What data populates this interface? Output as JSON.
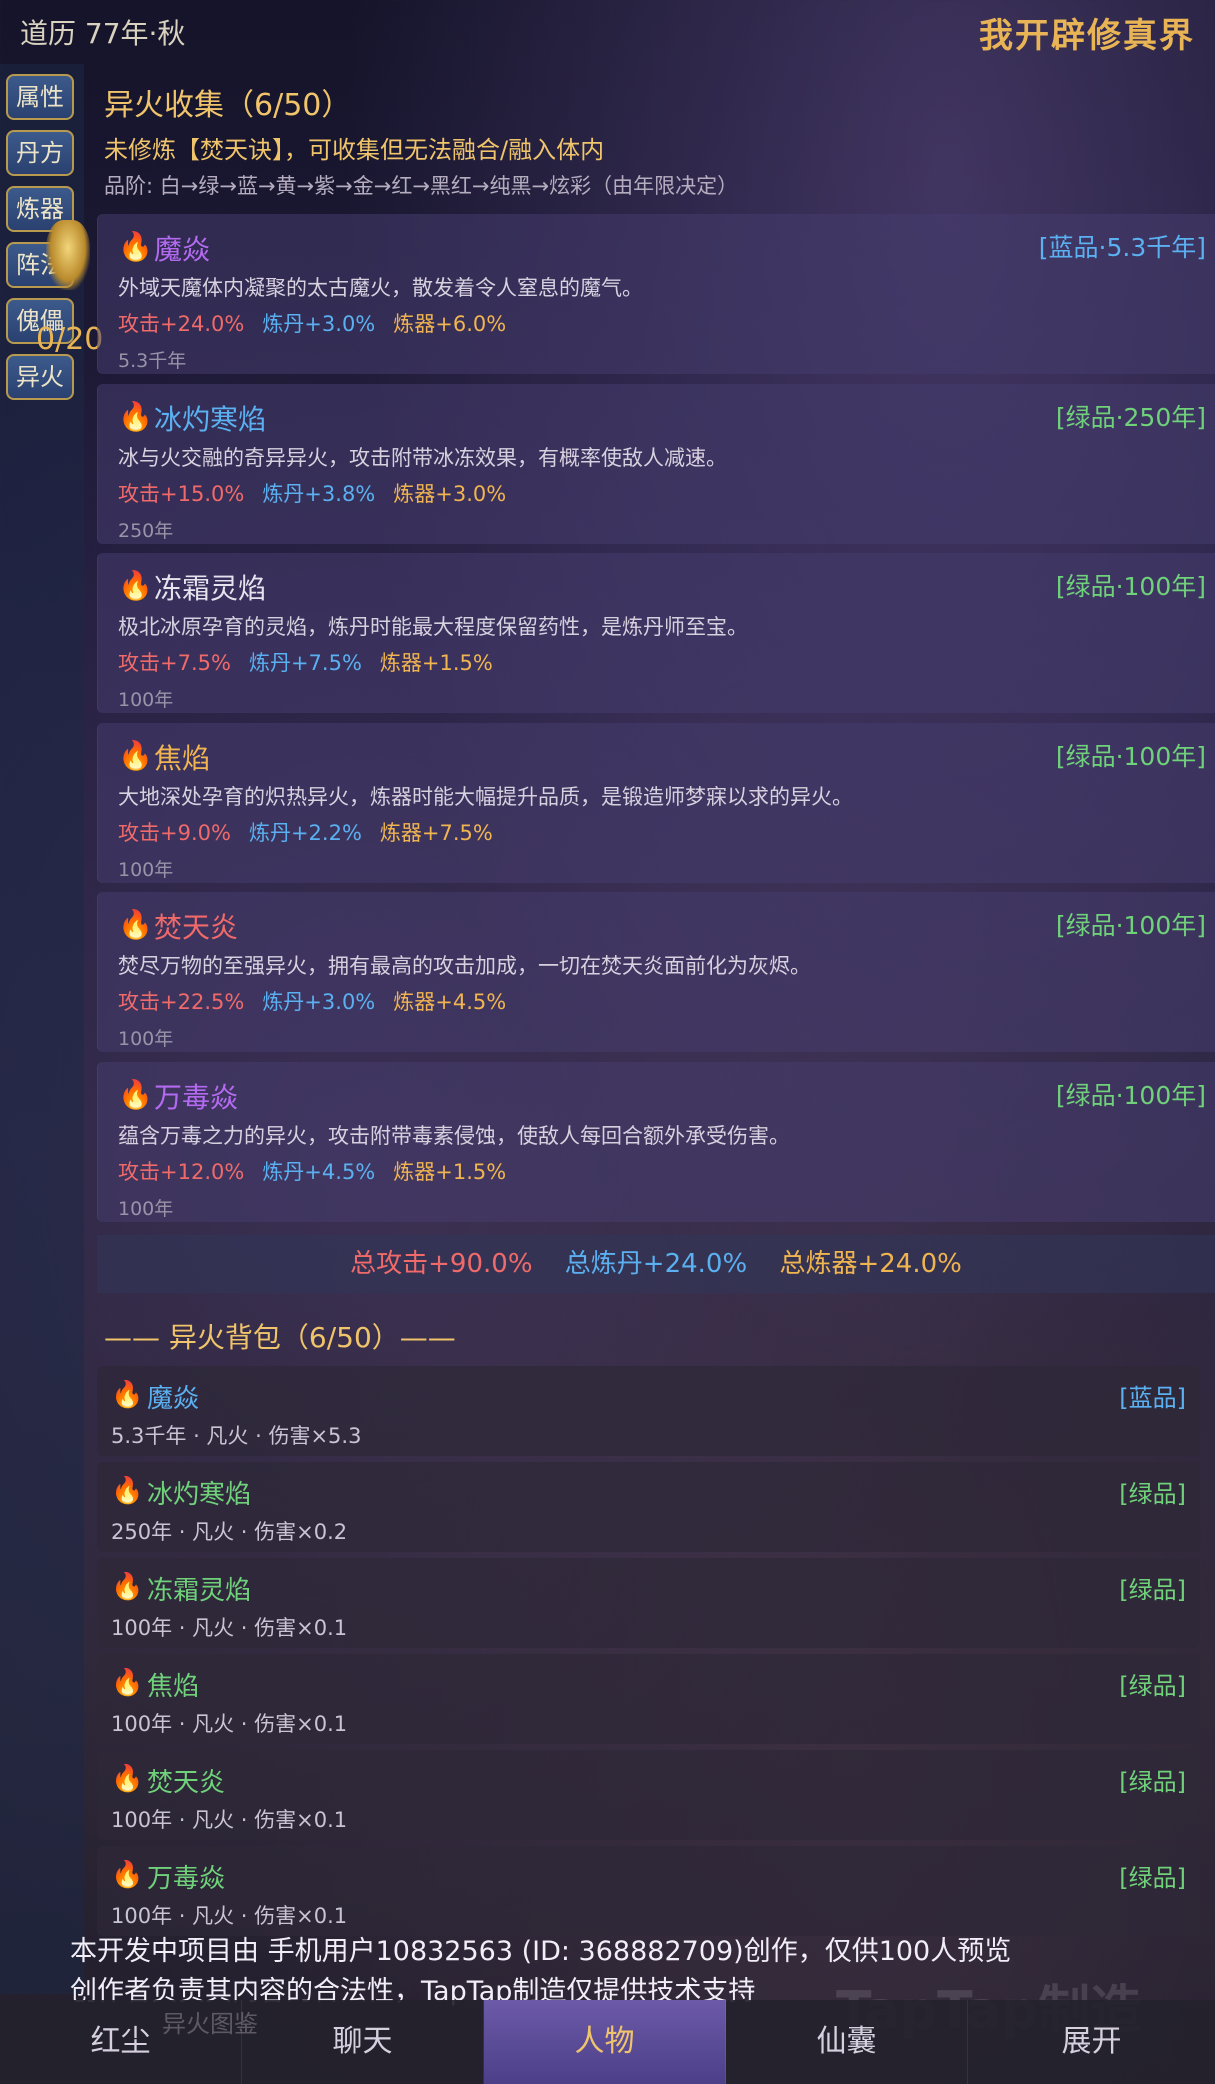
{
  "header": {
    "era": "道历 77年·秋",
    "title": "我开辟修真界"
  },
  "sidenav": {
    "items": [
      "属性",
      "丹方",
      "炼器",
      "阵法",
      "傀儡",
      "异火"
    ],
    "medal_count": "0/20"
  },
  "section": {
    "title": "异火收集（6/50）",
    "warning": "未修炼【焚天诀】，可收集但无法融合/融入体内",
    "grade_line": "品阶: 白→绿→蓝→黄→紫→金→红→黑红→纯黑→炫彩（由年限决定）"
  },
  "fires": [
    {
      "name": "魔焱",
      "tag": "[蓝品·5.3千年]",
      "desc": "外域天魔体内凝聚的太古魔火，散发着令人窒息的魔气。",
      "atk": "攻击+24.0%",
      "dan": "炼丹+3.0%",
      "qi": "炼器+6.0%",
      "age": "5.3千年",
      "name_color": "#b46af0",
      "tag_color": "#5ab0f0"
    },
    {
      "name": "冰灼寒焰",
      "tag": "[绿品·250年]",
      "desc": "冰与火交融的奇异异火，攻击附带冰冻效果，有概率使敌人减速。",
      "atk": "攻击+15.0%",
      "dan": "炼丹+3.8%",
      "qi": "炼器+3.0%",
      "age": "250年",
      "name_color": "#5ab0f0",
      "tag_color": "#6fd17a"
    },
    {
      "name": "冻霜灵焰",
      "tag": "[绿品·100年]",
      "desc": "极北冰原孕育的灵焰，炼丹时能最大程度保留药性，是炼丹师至宝。",
      "atk": "攻击+7.5%",
      "dan": "炼丹+7.5%",
      "qi": "炼器+1.5%",
      "age": "100年",
      "name_color": "#e6e2ee",
      "tag_color": "#6fd17a"
    },
    {
      "name": "焦焰",
      "tag": "[绿品·100年]",
      "desc": "大地深处孕育的炽热异火，炼器时能大幅提升品质，是锻造师梦寐以求的异火。",
      "atk": "攻击+9.0%",
      "dan": "炼丹+2.2%",
      "qi": "炼器+7.5%",
      "age": "100年",
      "name_color": "#f0b450",
      "tag_color": "#6fd17a"
    },
    {
      "name": "焚天炎",
      "tag": "[绿品·100年]",
      "desc": "焚尽万物的至强异火，拥有最高的攻击加成，一切在焚天炎面前化为灰烬。",
      "atk": "攻击+22.5%",
      "dan": "炼丹+3.0%",
      "qi": "炼器+4.5%",
      "age": "100年",
      "name_color": "#f06a6a",
      "tag_color": "#6fd17a"
    },
    {
      "name": "万毒焱",
      "tag": "[绿品·100年]",
      "desc": "蕴含万毒之力的异火，攻击附带毒素侵蚀，使敌人每回合额外承受伤害。",
      "atk": "攻击+12.0%",
      "dan": "炼丹+4.5%",
      "qi": "炼器+1.5%",
      "age": "100年",
      "name_color": "#b46af0",
      "tag_color": "#6fd17a"
    }
  ],
  "totals": {
    "atk": "总攻击+90.0%",
    "dan": "总炼丹+24.0%",
    "qi": "总炼器+24.0%"
  },
  "bag": {
    "title": "—— 异火背包（6/50）——",
    "items": [
      {
        "name": "魔焱",
        "tag": "[蓝品]",
        "meta": "5.3千年 · 凡火 · 伤害×5.3",
        "name_color": "#5ab0f0",
        "tag_color": "#5ab0f0"
      },
      {
        "name": "冰灼寒焰",
        "tag": "[绿品]",
        "meta": "250年 · 凡火 · 伤害×0.2",
        "name_color": "#6fd17a",
        "tag_color": "#6fd17a"
      },
      {
        "name": "冻霜灵焰",
        "tag": "[绿品]",
        "meta": "100年 · 凡火 · 伤害×0.1",
        "name_color": "#6fd17a",
        "tag_color": "#6fd17a"
      },
      {
        "name": "焦焰",
        "tag": "[绿品]",
        "meta": "100年 · 凡火 · 伤害×0.1",
        "name_color": "#6fd17a",
        "tag_color": "#6fd17a"
      },
      {
        "name": "焚天炎",
        "tag": "[绿品]",
        "meta": "100年 · 凡火 · 伤害×0.1",
        "name_color": "#6fd17a",
        "tag_color": "#6fd17a"
      },
      {
        "name": "万毒焱",
        "tag": "[绿品]",
        "meta": "100年 · 凡火 · 伤害×0.1",
        "name_color": "#6fd17a",
        "tag_color": "#6fd17a"
      }
    ]
  },
  "footer": {
    "line1": "本开发中项目由 手机用户10832563 (ID: 368882709)创作，仅供100人预览",
    "line2": "创作者负责其内容的合法性，TapTap制造仅提供技术支持",
    "watermark": "TapTap制造",
    "ghost": "异火图鉴"
  },
  "tabs": [
    {
      "label": "红尘",
      "active": false
    },
    {
      "label": "聊天",
      "active": false
    },
    {
      "label": "人物",
      "active": true
    },
    {
      "label": "仙囊",
      "active": false
    },
    {
      "label": "展开",
      "active": false
    }
  ],
  "icons": {
    "fire": "fire-icon"
  }
}
